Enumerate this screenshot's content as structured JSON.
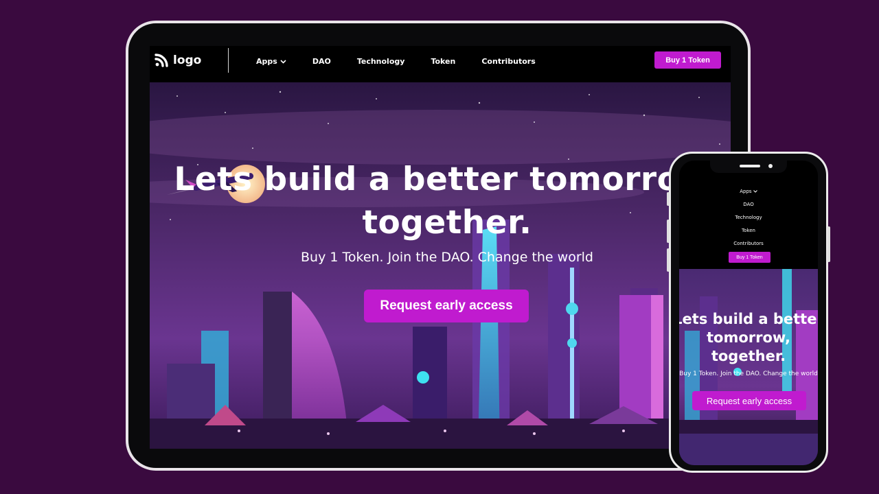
{
  "colors": {
    "background": "#3a0a3f",
    "accent": "#c01bcf",
    "sky_top": "#2a1642",
    "sky_mid": "#5c2f7a",
    "neon_cyan": "#3ee0f0",
    "neon_pink": "#e03ad0"
  },
  "tablet": {
    "nav": {
      "logo_text": "logo",
      "logo_icon": "rss-icon",
      "items": [
        {
          "label": "Apps",
          "has_dropdown": true
        },
        {
          "label": "DAO"
        },
        {
          "label": "Technology"
        },
        {
          "label": "Token"
        },
        {
          "label": "Contributors"
        }
      ],
      "cta_label": "Buy 1 Token"
    },
    "hero": {
      "headline": "Lets build a better tomorrow, together.",
      "subtitle": "Buy 1 Token. Join the DAO. Change the world",
      "cta_label": "Request early access"
    }
  },
  "phone": {
    "nav": {
      "items": [
        {
          "label": "Apps",
          "has_dropdown": true
        },
        {
          "label": "DAO"
        },
        {
          "label": "Technology"
        },
        {
          "label": "Token"
        },
        {
          "label": "Contributors"
        }
      ],
      "cta_label": "Buy 1 Token"
    },
    "hero": {
      "headline": "Lets build a better tomorrow, together.",
      "subtitle": "Buy 1 Token. Join the DAO. Change the world",
      "cta_label": "Request early access"
    }
  }
}
